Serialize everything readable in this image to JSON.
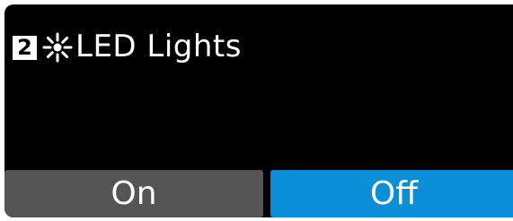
{
  "header": {
    "channel_number": "2",
    "icon": "led-sun-icon",
    "title": "LED Lights"
  },
  "buttons": {
    "on_label": "On",
    "off_label": "Off",
    "selected": "Off"
  },
  "colors": {
    "panel_bg": "#000000",
    "on_button_bg": "#555555",
    "off_button_bg": "#0a8fd6",
    "text": "#ffffff"
  }
}
